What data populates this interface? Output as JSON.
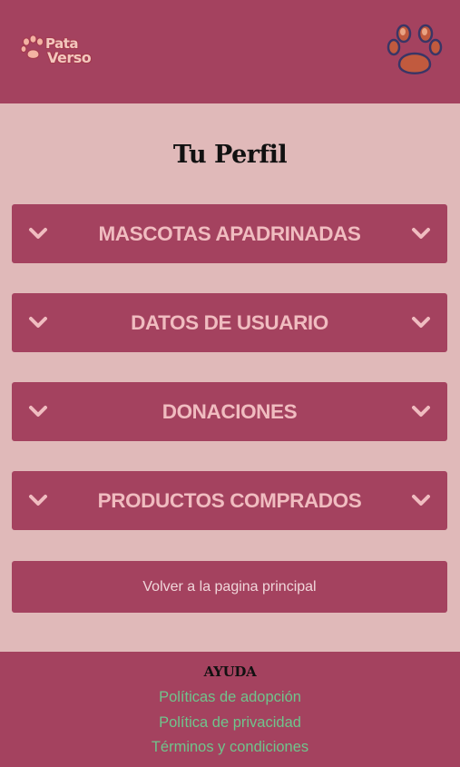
{
  "header": {
    "logo_line1": "Pata",
    "logo_line2": "Verso",
    "profile_icon": "paw-icon"
  },
  "page": {
    "title": "Tu Perfil"
  },
  "sections": [
    {
      "label": "MASCOTAS APADRINADAS"
    },
    {
      "label": "DATOS DE USUARIO"
    },
    {
      "label": "DONACIONES"
    },
    {
      "label": "PRODUCTOS COMPRADOS"
    }
  ],
  "back_button": {
    "label": "Volver a la pagina principal"
  },
  "footer": {
    "heading": "AYUDA",
    "links": [
      {
        "label": "Políticas de adopción"
      },
      {
        "label": "Política de privacidad"
      },
      {
        "label": "Términos y condiciones"
      }
    ]
  },
  "colors": {
    "primary": "#a4425f",
    "background": "#e0b9b9",
    "section_text": "#f0bcc0",
    "link": "#6fc48c",
    "paw_fill": "#c15a3e",
    "paw_outline": "#3a3566"
  }
}
